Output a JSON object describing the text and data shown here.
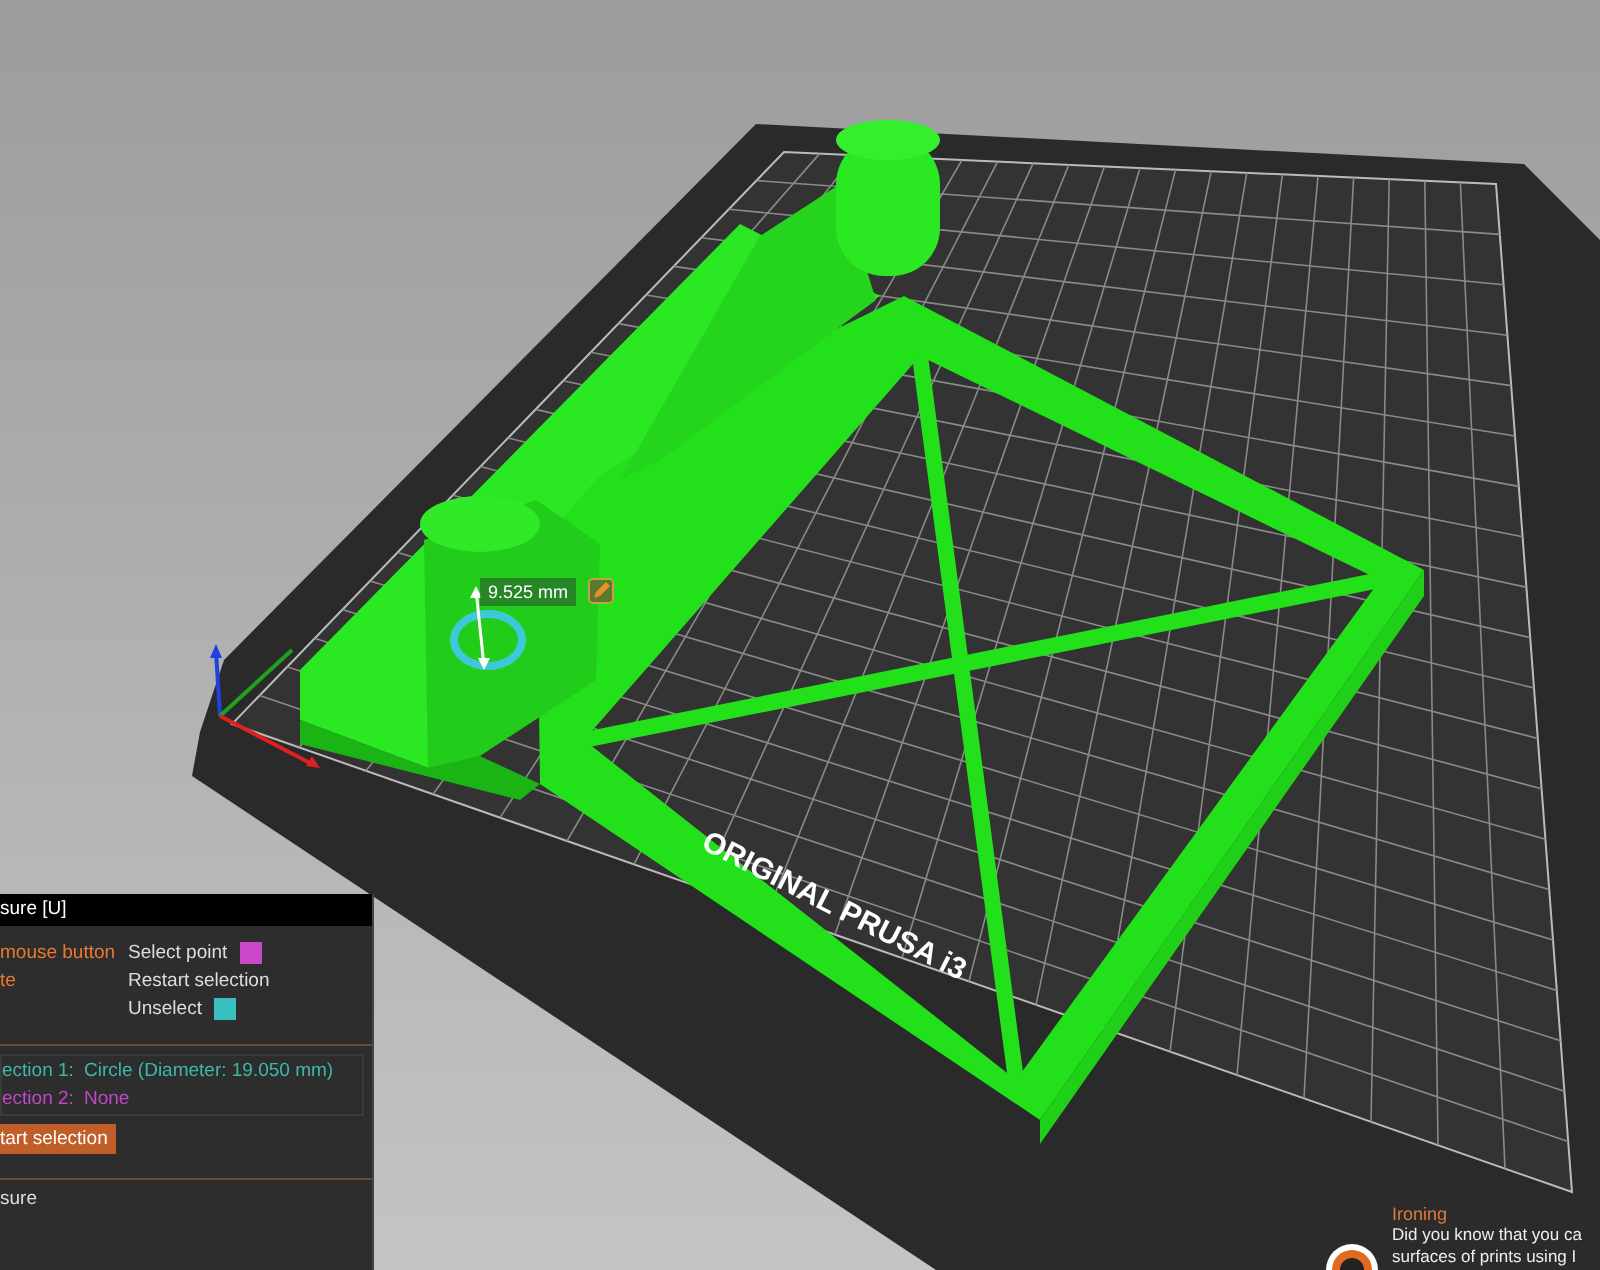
{
  "viewport": {
    "dimension_label": "9.525 mm",
    "bed_label": "ORIGINAL PRUSA i3"
  },
  "measure_panel": {
    "title": "sure [U]",
    "shortcuts": [
      {
        "key": "mouse button",
        "action": "Select point",
        "color": "#c848c8"
      },
      {
        "key": "te",
        "action": "Restart selection"
      },
      {
        "action": "Unselect",
        "color": "#38c0c0"
      }
    ],
    "selections": [
      {
        "label": "ection 1:",
        "value": "Circle (Diameter: 19.050 mm)",
        "color": "#3cb8a8"
      },
      {
        "label": "ection 2:",
        "value": "None",
        "color": "#c048c8"
      }
    ],
    "restart_button": "tart selection",
    "footer": "sure"
  },
  "notification": {
    "title": "Ironing",
    "lines": [
      "Did you know that you ca",
      "surfaces of prints using I"
    ]
  }
}
